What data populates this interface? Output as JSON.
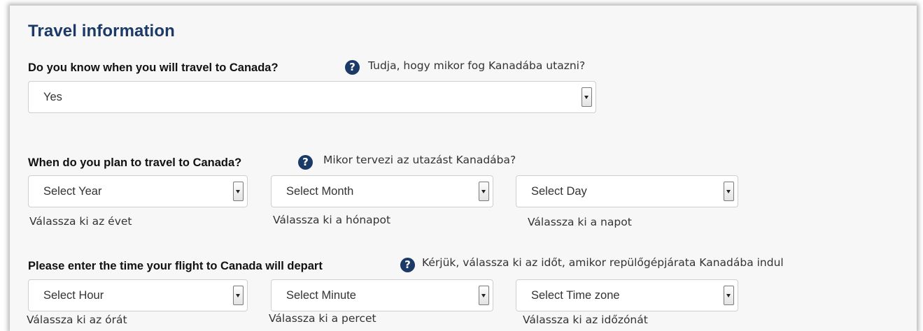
{
  "section": {
    "title": "Travel information"
  },
  "q1": {
    "label": "Do you know when you will travel to Canada?",
    "translation": "Tudja, hogy mikor fog Kanadába utazni?",
    "value": "Yes"
  },
  "q2": {
    "label": "When do you plan to travel to Canada?",
    "translation": "Mikor tervezi az utazást Kanadába?",
    "year": {
      "placeholder": "Select Year",
      "hint": "Válassza ki az évet"
    },
    "month": {
      "placeholder": "Select Month",
      "hint": "Válassza ki a hónapot"
    },
    "day": {
      "placeholder": "Select Day",
      "hint": "Válassza ki a napot"
    }
  },
  "q3": {
    "label": "Please enter the time your flight to Canada will depart",
    "translation": "Kérjük, válassza ki az időt, amikor repülőgépjárata Kanadába indul",
    "hour": {
      "placeholder": "Select Hour",
      "hint": "Válassza ki az órát"
    },
    "minute": {
      "placeholder": "Select Minute",
      "hint": "Válassza ki a percet"
    },
    "timezone": {
      "placeholder": "Select Time zone",
      "hint": "Válassza ki az időzónát"
    }
  },
  "icons": {
    "help": "question-circle-icon",
    "dropdown": "dropdown-arrow-icon"
  },
  "colors": {
    "title": "#1c3a68",
    "help_icon": "#1c3a68"
  },
  "help_glyph": "?"
}
